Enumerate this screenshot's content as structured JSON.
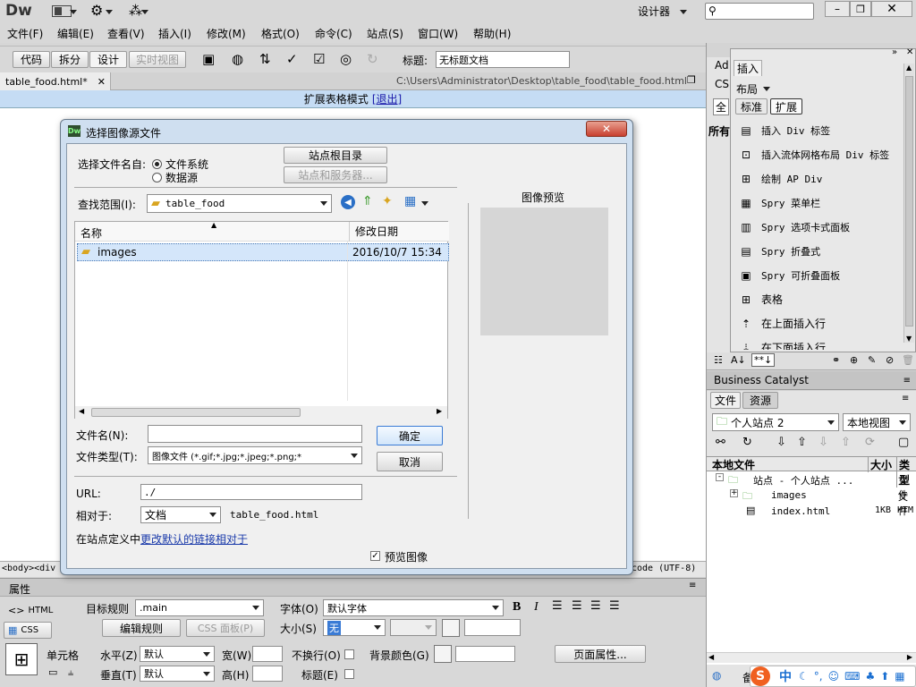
{
  "app": {
    "logo": "Dw",
    "workspace": "设计器"
  },
  "menu": [
    "文件(F)",
    "编辑(E)",
    "查看(V)",
    "插入(I)",
    "修改(M)",
    "格式(O)",
    "命令(C)",
    "站点(S)",
    "窗口(W)",
    "帮助(H)"
  ],
  "viewbar": {
    "code": "代码",
    "split": "拆分",
    "design": "设计",
    "live": "实时视图",
    "title_label": "标题:",
    "title_value": "无标题文档"
  },
  "doc": {
    "tab": "table_food.html*",
    "path": "C:\\Users\\Administrator\\Desktop\\table_food\\table_food.html",
    "mode_text": "扩展表格模式",
    "mode_exit": "[退出]",
    "tag_path": "<body><div",
    "encoding": "code (UTF-8)"
  },
  "dialog": {
    "title": "选择图像源文件",
    "select_from_label": "选择文件名自:",
    "radio_fs": "文件系统",
    "radio_ds": "数据源",
    "site_root": "站点根目录",
    "site_server": "站点和服务器...",
    "look_in_label": "查找范围(I):",
    "look_in_value": "table_food",
    "col_name": "名称",
    "col_date": "修改日期",
    "file_name": "images",
    "file_date": "2016/10/7 15:34",
    "filename_label": "文件名(N):",
    "filetype_label": "文件类型(T):",
    "filetype_value": "图像文件 (*.gif;*.jpg;*.jpeg;*.png;*",
    "ok": "确定",
    "cancel": "取消",
    "url_label": "URL:",
    "url_value": "./",
    "relative_label": "相对于:",
    "relative_value": "文档",
    "relative_file": "table_food.html",
    "site_def_prefix": "在站点定义中",
    "site_def_link": "更改默认的链接相对于",
    "preview_checkbox": "预览图像",
    "preview_title": "图像预览"
  },
  "insert_panel": {
    "tab_ad": "Ad",
    "tab_cs": "CS",
    "tab_all": "全",
    "tab_all2": "所有",
    "tab": "插入",
    "category": "布局",
    "std": "标准",
    "ext": "扩展",
    "items": [
      "插入 Div 标签",
      "插入流体网格布局 Div 标签",
      "绘制 AP Div",
      "Spry 菜单栏",
      "Spry 选项卡式面板",
      "Spry 折叠式",
      "Spry 可折叠面板",
      "表格",
      "在上面插入行",
      "在下面插入行"
    ]
  },
  "business_catalyst": "Business Catalyst",
  "files_panel": {
    "tab_files": "文件",
    "tab_assets": "资源",
    "site": "个人站点 2",
    "view": "本地视图",
    "col_local": "本地文件",
    "col_size": "大小",
    "col_type": "类型",
    "root": "站点 - 个人站点 ...",
    "root_type": "文件",
    "rows": [
      {
        "name": "images",
        "size": "",
        "type": "文件"
      },
      {
        "name": "index.html",
        "size": "1KB",
        "type": "HTM"
      }
    ],
    "status": "备"
  },
  "props": {
    "title": "属性",
    "html": "HTML",
    "css": "CSS",
    "target_rule_label": "目标规则",
    "target_rule_value": ".main",
    "edit_rule": "编辑规则",
    "css_panel": "CSS 面板(P)",
    "font_label": "字体(O)",
    "font_value": "默认字体",
    "size_label": "大小(S)",
    "size_value": "无",
    "cell_label": "单元格",
    "h_label": "水平(Z)",
    "h_value": "默认",
    "v_label": "垂直(T)",
    "v_value": "默认",
    "w_label": "宽(W)",
    "h2_label": "高(H)",
    "nowrap_label": "不换行(O)",
    "header_label": "标题(E)",
    "bg_label": "背景颜色(G)",
    "page_props": "页面属性..."
  },
  "ime": {
    "logo": "S",
    "lang": "中"
  }
}
